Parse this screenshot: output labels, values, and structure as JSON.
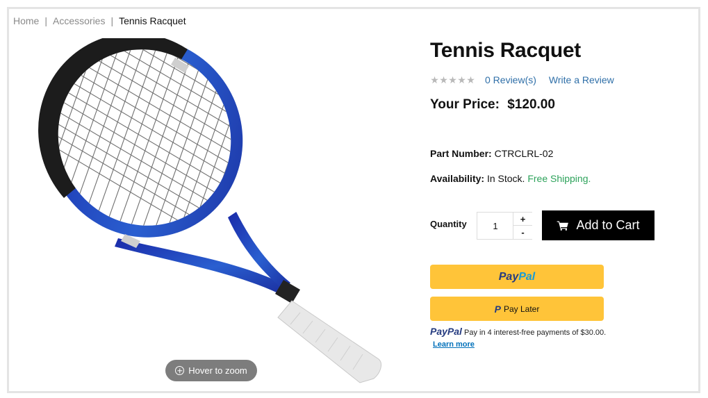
{
  "breadcrumb": {
    "home": "Home",
    "category": "Accessories",
    "current": "Tennis Racquet",
    "separator": "|"
  },
  "product": {
    "title": "Tennis Racquet",
    "rating": {
      "stars": 0,
      "max": 5,
      "reviews_label": "0 Review(s)",
      "write_review_label": "Write a Review"
    },
    "price_label": "Your Price:",
    "price_value": "$120.00",
    "part_number_label": "Part Number:",
    "part_number_value": "CTRCLRL-02",
    "availability_label": "Availability:",
    "availability_value": "In Stock.",
    "shipping_value": "Free Shipping."
  },
  "purchase": {
    "quantity_label": "Quantity",
    "quantity_value": "1",
    "increment_label": "+",
    "decrement_label": "-",
    "add_to_cart_label": "Add to Cart"
  },
  "paypal": {
    "main_button": {
      "pay": "Pay",
      "pal": "Pal"
    },
    "later_button": {
      "p": "P",
      "label": "Pay Later"
    },
    "message": {
      "logo_pay": "PayPal",
      "text": "Pay in 4 interest-free payments of $30.00.",
      "learn_more": "Learn more"
    }
  },
  "image": {
    "zoom_hint": "Hover to zoom"
  },
  "colors": {
    "link": "#2f6fa8",
    "free_shipping": "#2ca25a",
    "paypal_yellow": "#ffc439",
    "paypal_dark_blue": "#253b80",
    "paypal_light_blue": "#179bd7",
    "cart_button": "#000000"
  }
}
